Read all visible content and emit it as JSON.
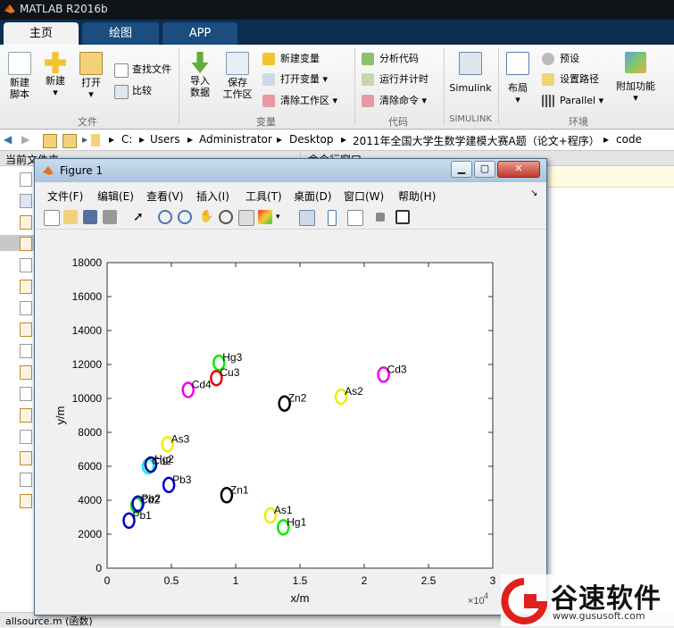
{
  "app": {
    "title": "MATLAB R2016b"
  },
  "tabs": [
    "主页",
    "绘图",
    "APP"
  ],
  "ribbon": {
    "new_script": "新建\n脚本",
    "new": "新建",
    "open": "打开",
    "find_files": "查找文件",
    "compare": "比较",
    "import_data": "导入\n数据",
    "save_workspace": "保存\n工作区",
    "new_variable": "新建变量",
    "open_variable": "打开变量",
    "clear_workspace": "清除工作区",
    "analyze_code": "分析代码",
    "run_and_time": "运行并计时",
    "clear_commands": "清除命令",
    "simulink": "Simulink",
    "layout": "布局",
    "preferences": "预设",
    "set_path": "设置路径",
    "parallel": "Parallel",
    "addons": "附加功能",
    "sections": {
      "file": "文件",
      "variable": "变量",
      "code": "代码",
      "simulink": "SIMULINK",
      "environment": "环境"
    }
  },
  "path": [
    "C:",
    "Users",
    "Administrator",
    "Desktop",
    "2011年全国大学生数学建模大赛A题（论文+程序）",
    "code"
  ],
  "left_panel": {
    "title": "当前文件夹"
  },
  "right_panel": {
    "title": "命令行窗口"
  },
  "status": {
    "text": "allsource.m  (函数)"
  },
  "figure": {
    "title": "Figure 1",
    "menu": [
      "文件(F)",
      "编辑(E)",
      "查看(V)",
      "插入(I)",
      "工具(T)",
      "桌面(D)",
      "窗口(W)",
      "帮助(H)"
    ]
  },
  "chart_data": {
    "type": "scatter",
    "xlabel": "x/m",
    "ylabel": "y/m",
    "x_exponent_label": "×10",
    "x_exponent": "4",
    "xlim": [
      0,
      30000
    ],
    "ylim": [
      0,
      18000
    ],
    "xticks": [
      0,
      5000,
      10000,
      15000,
      20000,
      25000,
      30000
    ],
    "xtick_labels": [
      "0",
      "0.5",
      "1",
      "1.5",
      "2",
      "2.5",
      "3"
    ],
    "yticks": [
      0,
      2000,
      4000,
      6000,
      8000,
      10000,
      12000,
      14000,
      16000,
      18000
    ],
    "ytick_labels": [
      "0",
      "2000",
      "4000",
      "6000",
      "8000",
      "10000",
      "12000",
      "14000",
      "16000",
      "18000"
    ],
    "points": [
      {
        "label": "Hg3",
        "x": 8700,
        "y": 12100,
        "color": "#00ee00"
      },
      {
        "label": "Cu3",
        "x": 8500,
        "y": 11200,
        "color": "#ee0000"
      },
      {
        "label": "Cd4",
        "x": 6300,
        "y": 10500,
        "color": "#ee00ee"
      },
      {
        "label": "Cd3",
        "x": 21500,
        "y": 11400,
        "color": "#ee00ee"
      },
      {
        "label": "Zn2",
        "x": 13800,
        "y": 9700,
        "color": "#000000"
      },
      {
        "label": "As2",
        "x": 18200,
        "y": 10100,
        "color": "#eeee00"
      },
      {
        "label": "As3",
        "x": 4700,
        "y": 7300,
        "color": "#eeee00"
      },
      {
        "label": "Cu2",
        "x": 3200,
        "y": 6000,
        "color": "#00eeee"
      },
      {
        "label": "Hg2",
        "x": 3400,
        "y": 6100,
        "color": "#000080"
      },
      {
        "label": "Pb3",
        "x": 4800,
        "y": 4900,
        "color": "#0000cc"
      },
      {
        "label": "Zn1",
        "x": 9300,
        "y": 4300,
        "color": "#000000"
      },
      {
        "label": "Cd2",
        "x": 2300,
        "y": 3700,
        "color": "#00ee00"
      },
      {
        "label": "Pb2",
        "x": 2400,
        "y": 3800,
        "color": "#0000cc"
      },
      {
        "label": "As1",
        "x": 12700,
        "y": 3100,
        "color": "#eeee00"
      },
      {
        "label": "Hg1",
        "x": 13700,
        "y": 2400,
        "color": "#00ee00"
      },
      {
        "label": "Pb1",
        "x": 1700,
        "y": 2800,
        "color": "#0000cc"
      }
    ],
    "grid": false
  },
  "watermark": {
    "brand": "谷速软件",
    "url": "www.gususoft.com"
  }
}
